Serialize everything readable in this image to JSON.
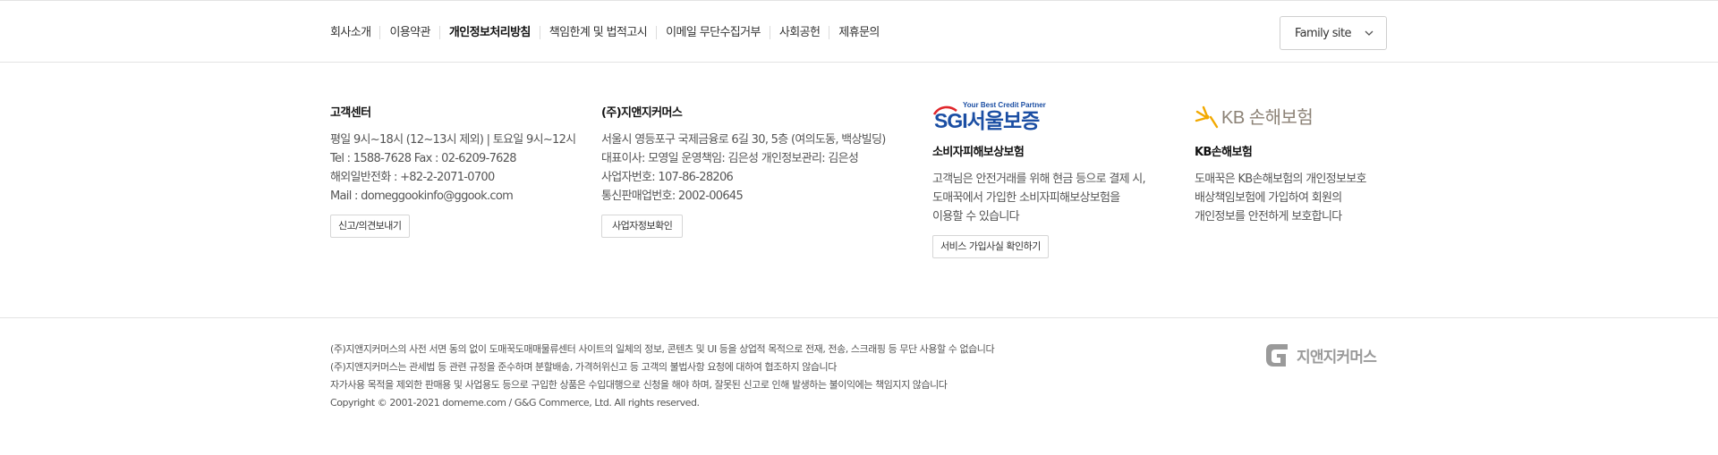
{
  "nav": {
    "links": [
      "회사소개",
      "이용약관",
      "개인정보처리방침",
      "책임한계 및 법적고시",
      "이메일 무단수집거부",
      "사회공헌",
      "제휴문의"
    ],
    "family_site": "Family site"
  },
  "customer_center": {
    "title": "고객센터",
    "lines": [
      "평일 9시~18시 (12~13시 제외) | 토요일 9시~12시",
      "Tel : 1588-7628 Fax : 02-6209-7628",
      "해외일반전화 : +82-2-2071-0700",
      "Mail : domeggookinfo@ggook.com"
    ],
    "button": "신고/의견보내기"
  },
  "company": {
    "title": "(주)지앤지커머스",
    "lines": [
      "서울시 영등포구 국제금융로 6길 30, 5층 (여의도동, 백상빌딩)",
      "대표이사: 모영일 운영책임: 김은성 개인정보관리: 김은성",
      "사업자번호: 107-86-28206",
      "통신판매업번호: 2002-00645"
    ],
    "button": "사업자정보확인"
  },
  "sgi": {
    "logo_tagline": "Your Best Credit Partner",
    "logo_text": "SGI서울보증",
    "title": "소비자피해보상보험",
    "lines": [
      "고객님은 안전거래를 위해 현금 등으로 결제 시,",
      "도매꾹에서 가입한 소비자피해보상보험을",
      "이용할 수 있습니다"
    ],
    "button": "서비스 가입사실 확인하기"
  },
  "kb": {
    "logo_text": "KB 손해보험",
    "title": "KB손해보험",
    "lines": [
      "도매꾹은 KB손해보험의 개인정보보호",
      "배상책임보험에 가입하여 회원의",
      "개인정보를 안전하게 보호합니다"
    ]
  },
  "legal": {
    "lines": [
      "(주)지앤지커머스의 사전 서면 동의 없이 도매꾹도매매물류센터 사이트의 일체의 정보, 콘텐츠 및 UI 등을 상업적 목적으로 전재, 전송, 스크래핑 등 무단 사용할 수 없습니다",
      "(주)지앤지커머스는 관세법 등 관련 규정을 준수하며 분할배송, 가격허위신고 등 고객의 불법사항 요청에 대하여 협조하지 않습니다",
      "자가사용 목적을 제외한 판매용 및 사업용도 등으로 구입한 상품은 수입대행으로 신청을 해야 하며, 잘못된 신고로 인해 발생하는 불이익에는 책임지지 않습니다",
      "Copyright © 2001-2021 domeme.com / G&G Commerce, Ltd. All rights reserved."
    ]
  },
  "footer_logo": {
    "text": "지앤지커머스"
  },
  "colors": {
    "sgi_blue": "#1b4ea3",
    "sgi_red": "#e0262b",
    "kb_yellow": "#f2a900",
    "kb_gray": "#8c8276",
    "logo_gray": "#9a9a9a"
  }
}
